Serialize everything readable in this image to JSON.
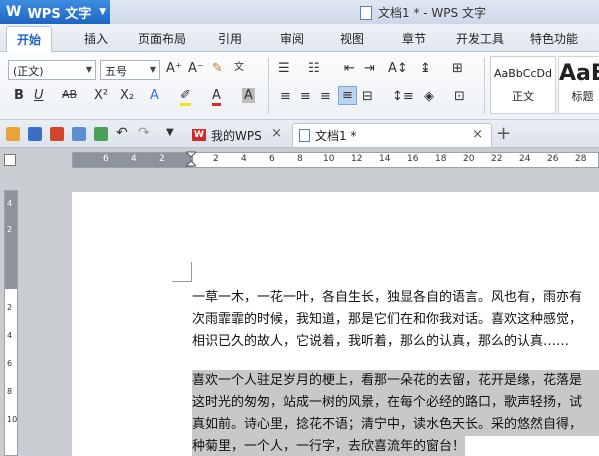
{
  "app": {
    "app_button_label": "WPS 文字",
    "window_title": "文档1 * - WPS 文字"
  },
  "ribbon_tabs": [
    "开始",
    "插入",
    "页面布局",
    "引用",
    "审阅",
    "视图",
    "章节",
    "开发工具",
    "特色功能"
  ],
  "toolbar": {
    "font_name": "(正文)",
    "font_size": "五号",
    "styles": [
      {
        "sample": "AaBbCcDd",
        "name": "正文"
      },
      {
        "sample": "AaB",
        "name": "标题"
      }
    ]
  },
  "doc_tabs": [
    {
      "label": "我的WPS"
    },
    {
      "label": "文档1 *"
    }
  ],
  "ruler": {
    "h_numbers": [
      "6",
      "4",
      "2",
      "2",
      "4",
      "6",
      "8",
      "10",
      "12",
      "14",
      "16",
      "18",
      "20",
      "22",
      "24",
      "26",
      "28"
    ],
    "v_numbers": [
      "4",
      "2",
      "2",
      "4",
      "6",
      "8",
      "10"
    ]
  },
  "document": {
    "paragraph1": [
      "一草一木，一花一叶，各自生长，独显各自的语言。风也有，雨亦有",
      "次雨霏霏的时候，我知道，那是它们在和你我对话。喜欢这种感觉，",
      "相识已久的故人，它说着，我听着，那么的认真，那么的认真……"
    ],
    "paragraph2": [
      "喜欢一个人驻足岁月的梗上，看那一朵花的去留，花开是缘，花落是",
      "这时光的匆匆，站成一树的风景，在每个必经的路口，歌声轻扬，试",
      "真如前。诗心里，捻花不语；清宁中，读水色天长。采的悠然自得，",
      "种菊里，一个人，一行字，去欣喜流年的窗台！"
    ]
  },
  "colors": {
    "accent": "#1f65c4",
    "selection": "#c8c8c8"
  }
}
